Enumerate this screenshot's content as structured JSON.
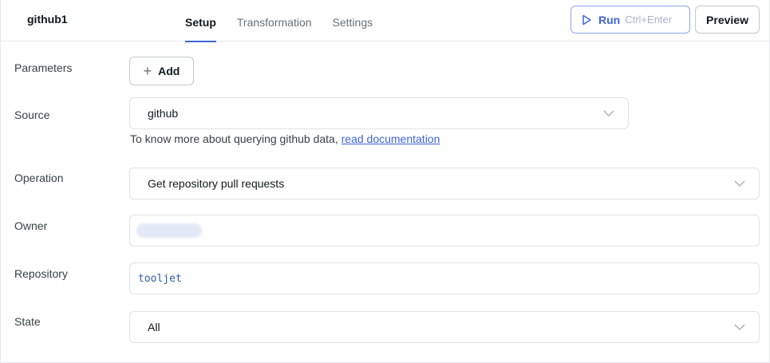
{
  "header": {
    "query_name": "github1",
    "tabs": [
      {
        "label": "Setup",
        "active": true
      },
      {
        "label": "Transformation",
        "active": false
      },
      {
        "label": "Settings",
        "active": false
      }
    ],
    "run": {
      "label": "Run",
      "shortcut": "Ctrl+Enter",
      "icon": "play-icon"
    },
    "preview_label": "Preview"
  },
  "form": {
    "parameters": {
      "label": "Parameters",
      "add_label": "Add",
      "add_icon": "plus-icon"
    },
    "source": {
      "label": "Source",
      "value": "github",
      "help_prefix": "To know more about querying github data, ",
      "help_link": "read documentation"
    },
    "operation": {
      "label": "Operation",
      "value": "Get repository pull requests"
    },
    "owner": {
      "label": "Owner",
      "value": ""
    },
    "repository": {
      "label": "Repository",
      "value": "tooljet"
    },
    "state": {
      "label": "State",
      "value": "All"
    }
  },
  "colors": {
    "accent": "#3e63dd",
    "border": "#dfe3e6",
    "text": "#11181c",
    "muted": "#687076"
  }
}
